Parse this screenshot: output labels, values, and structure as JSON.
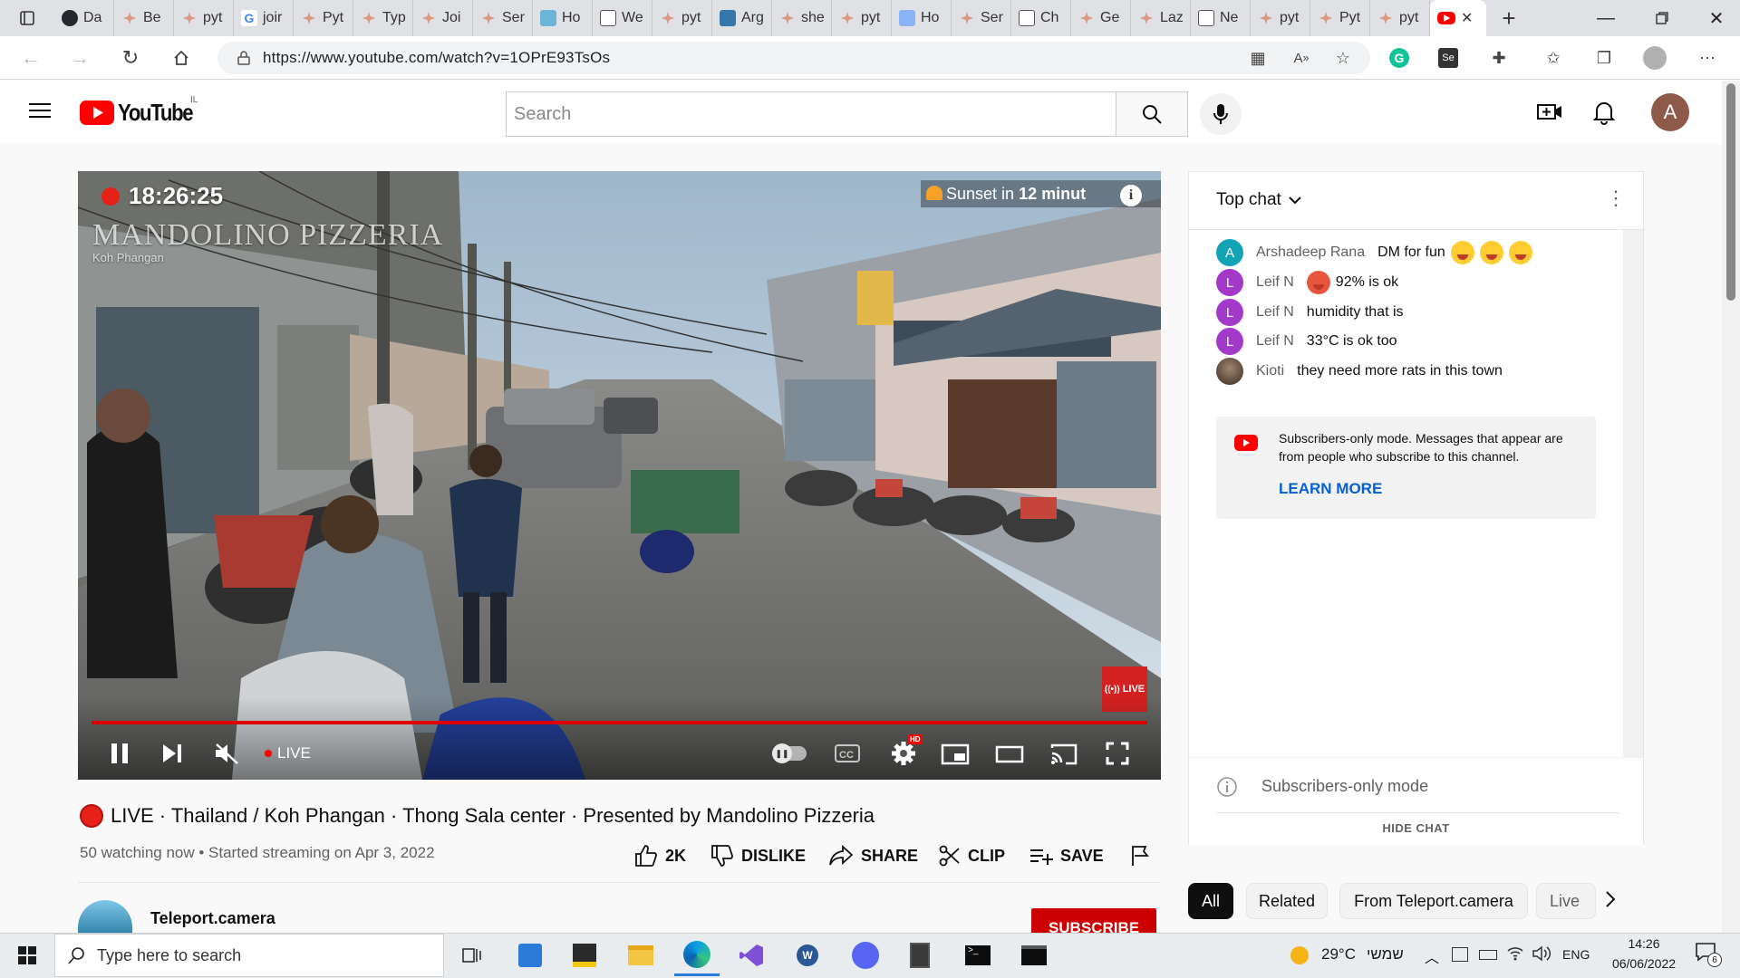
{
  "browser": {
    "tabs": [
      {
        "label": "Da",
        "fav": "github"
      },
      {
        "label": "Be",
        "fav": "claude"
      },
      {
        "label": "pyt",
        "fav": "claude"
      },
      {
        "label": "joir",
        "fav": "google"
      },
      {
        "label": "Pyt",
        "fav": "claude"
      },
      {
        "label": "Typ",
        "fav": "claude"
      },
      {
        "label": "Joi",
        "fav": "claude"
      },
      {
        "label": "Ser",
        "fav": "claude"
      },
      {
        "label": "Ho",
        "fav": "fish"
      },
      {
        "label": "We",
        "fav": "doc"
      },
      {
        "label": "pyt",
        "fav": "claude"
      },
      {
        "label": "Arg",
        "fav": "python"
      },
      {
        "label": "she",
        "fav": "claude"
      },
      {
        "label": "pyt",
        "fav": "claude"
      },
      {
        "label": "Ho",
        "fav": "globe"
      },
      {
        "label": "Ser",
        "fav": "claude"
      },
      {
        "label": "Ch",
        "fav": "doc"
      },
      {
        "label": "Ge",
        "fav": "claude"
      },
      {
        "label": "Laz",
        "fav": "claude"
      },
      {
        "label": "Ne",
        "fav": "news"
      },
      {
        "label": "pyt",
        "fav": "claude"
      },
      {
        "label": "Pyt",
        "fav": "claude"
      },
      {
        "label": "pyt",
        "fav": "claude"
      }
    ],
    "url": "https://www.youtube.com/watch?v=1OPrE93TsOs"
  },
  "youtube": {
    "logo_text": "YouTube",
    "country": "IL",
    "search_placeholder": "Search",
    "avatar_letter": "A"
  },
  "video": {
    "time_overlay": "18:26:25",
    "watermark_title": "MANDOLINO PIZZERIA",
    "watermark_sub": "Koh Phangan",
    "sunset_text": "Sunset in ",
    "sunset_bold": "12 minut",
    "live_badge": "LIVE",
    "controls_live": "LIVE",
    "hd_badge": "HD"
  },
  "info": {
    "title": "LIVE · Thailand / Koh Phangan · Thong Sala center · Presented by Mandolino Pizzeria",
    "meta": "50 watching now • Started streaming on Apr 3, 2022",
    "likes": "2K",
    "dislike": "DISLIKE",
    "share": "SHARE",
    "clip": "CLIP",
    "save": "SAVE",
    "channel": "Teleport.camera",
    "subscribe": "SUBSCRIBE"
  },
  "chat": {
    "header": "Top chat",
    "messages": [
      {
        "author": "Arshadeep Rana",
        "text": "DM for fun",
        "avatar": "A",
        "color": "#12a4b5",
        "emojis": 3
      },
      {
        "author": "Leif N",
        "text": "92% is ok",
        "avatar": "L",
        "color": "#a339c9",
        "emojis": 0,
        "lead_emoji": true
      },
      {
        "author": "Leif N",
        "text": "humidity that is",
        "avatar": "L",
        "color": "#a339c9",
        "emojis": 0
      },
      {
        "author": "Leif N",
        "text": "33°C is ok too",
        "avatar": "L",
        "color": "#a339c9",
        "emojis": 0
      },
      {
        "author": "Kioti",
        "text": "they need more rats in this town",
        "avatar": "",
        "color": "#5a4a3a",
        "emojis": 0
      }
    ],
    "notice": "Subscribers-only mode. Messages that appear are from people who subscribe to this channel.",
    "learn_more": "LEARN MORE",
    "mode": "Subscribers-only mode",
    "hide_chat": "HIDE CHAT"
  },
  "filters": [
    "All",
    "Related",
    "From Teleport.camera",
    "Live"
  ],
  "taskbar": {
    "search_placeholder": "Type here to search",
    "temp": "29°C",
    "weather_word": "שמשי",
    "lang": "ENG",
    "time": "14:26",
    "date": "06/06/2022",
    "notifications": "6"
  }
}
